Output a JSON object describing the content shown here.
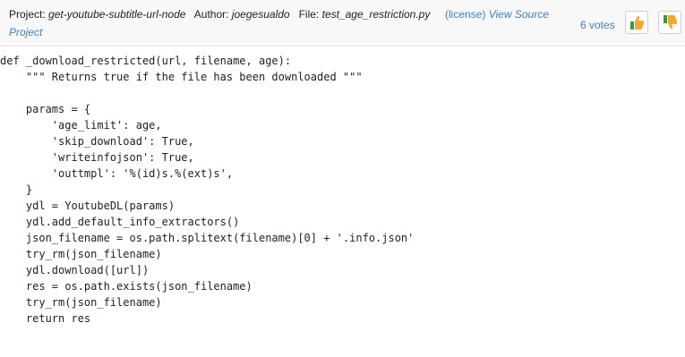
{
  "header": {
    "project_label": "Project:",
    "project_value": "get-youtube-subtitle-url-node",
    "author_label": "Author:",
    "author_value": "joegesualdo",
    "file_label": "File:",
    "file_value": "test_age_restriction.py",
    "license_link": "(license)",
    "view_source_link": "View Source Project",
    "votes": "6 votes",
    "upvote_icon": "thumbs-up-icon",
    "downvote_icon": "thumbs-down-icon"
  },
  "code": {
    "lines": [
      "def _download_restricted(url, filename, age):",
      "    \"\"\" Returns true if the file has been downloaded \"\"\"",
      "",
      "    params = {",
      "        'age_limit': age,",
      "        'skip_download': True,",
      "        'writeinfojson': True,",
      "        'outtmpl': '%(id)s.%(ext)s',",
      "    }",
      "    ydl = YoutubeDL(params)",
      "    ydl.add_default_info_extractors()",
      "    json_filename = os.path.splitext(filename)[0] + '.info.json'",
      "    try_rm(json_filename)",
      "    ydl.download([url])",
      "    res = os.path.exists(json_filename)",
      "    try_rm(json_filename)",
      "    return res"
    ]
  },
  "colors": {
    "link": "#3d7fcc",
    "header_bg": "#f8f8f8",
    "thumb_up": "#f0a92e",
    "thumb_up_cuff": "#3a9a3a",
    "thumb_down": "#f0a92e",
    "thumb_down_cuff": "#3a9a3a"
  }
}
